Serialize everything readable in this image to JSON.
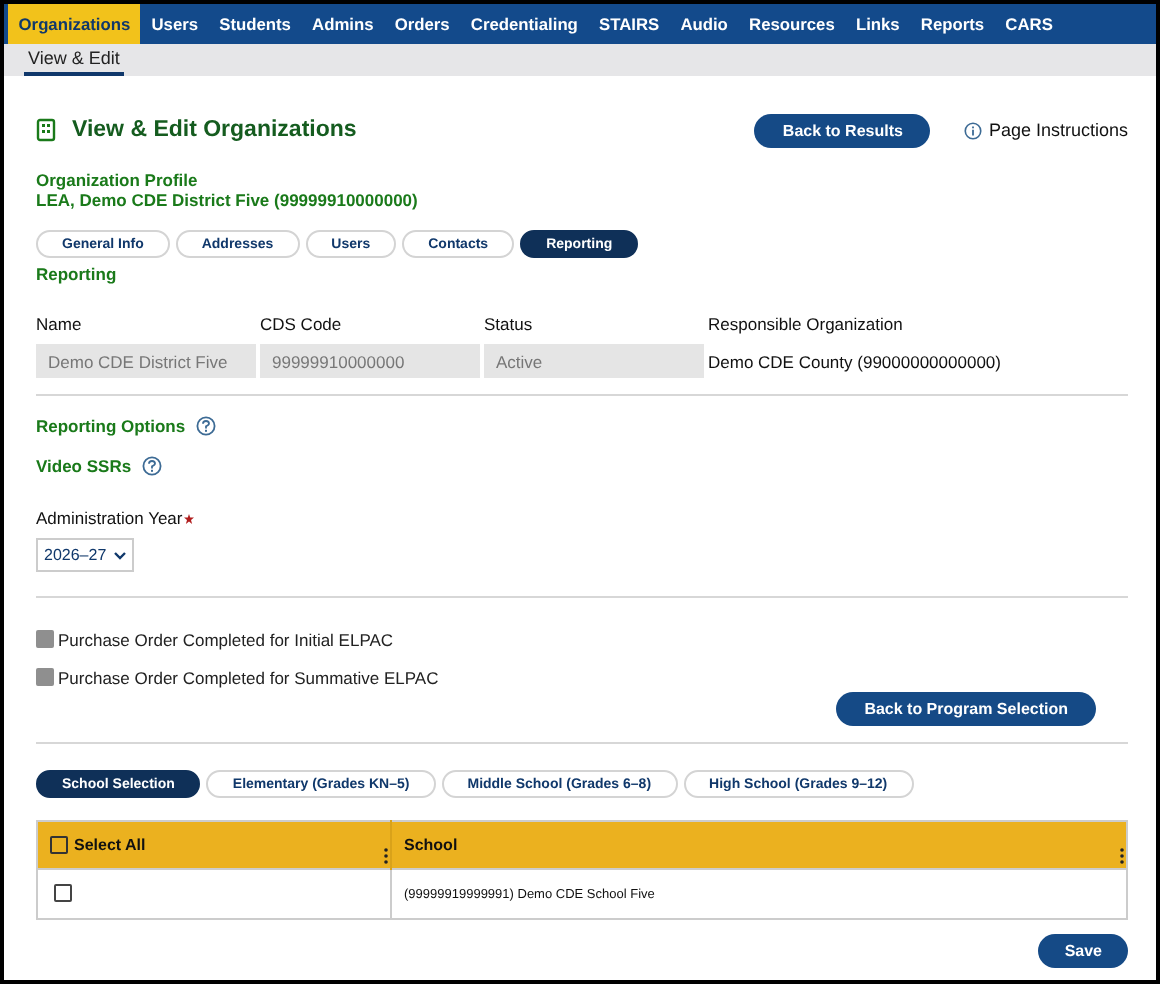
{
  "nav": {
    "items": [
      {
        "label": "Organizations",
        "selected": true
      },
      {
        "label": "Users",
        "selected": false
      },
      {
        "label": "Students",
        "selected": false
      },
      {
        "label": "Admins",
        "selected": false
      },
      {
        "label": "Orders",
        "selected": false
      },
      {
        "label": "Credentialing",
        "selected": false
      },
      {
        "label": "STAIRS",
        "selected": false
      },
      {
        "label": "Audio",
        "selected": false
      },
      {
        "label": "Resources",
        "selected": false
      },
      {
        "label": "Links",
        "selected": false
      },
      {
        "label": "Reports",
        "selected": false
      },
      {
        "label": "CARS",
        "selected": false
      }
    ]
  },
  "subnav": {
    "items": [
      {
        "label": "View & Edit",
        "selected": true
      }
    ]
  },
  "page": {
    "title": "View & Edit Organizations",
    "back_button": "Back to Results",
    "instructions": "Page Instructions"
  },
  "profile": {
    "heading": "Organization Profile",
    "name": "LEA, Demo CDE District Five (99999910000000)"
  },
  "tabs": [
    {
      "label": "General Info",
      "selected": false
    },
    {
      "label": "Addresses",
      "selected": false
    },
    {
      "label": "Users",
      "selected": false
    },
    {
      "label": "Contacts",
      "selected": false
    },
    {
      "label": "Reporting",
      "selected": true
    }
  ],
  "section_title": "Reporting",
  "fields": [
    {
      "label": "Name",
      "value": "Demo CDE District Five",
      "disabled": true
    },
    {
      "label": "CDS Code",
      "value": "99999910000000",
      "disabled": true
    },
    {
      "label": "Status",
      "value": "Active",
      "disabled": true
    },
    {
      "label": "Responsible Organization",
      "value": "Demo CDE County (99000000000000)",
      "disabled": false
    }
  ],
  "reporting_options": "Reporting Options",
  "video_ssrs": "Video SSRs",
  "admin_year": {
    "label": "Administration Year",
    "required": true,
    "value": "2026–27"
  },
  "purchase_orders": [
    {
      "label": "Purchase Order Completed for Initial ELPAC",
      "checked": false,
      "disabled": true
    },
    {
      "label": "Purchase Order Completed for Summative ELPAC",
      "checked": false,
      "disabled": true
    }
  ],
  "program_button": "Back to Program Selection",
  "school_tabs": [
    {
      "label": "School Selection",
      "selected": true
    },
    {
      "label": "Elementary (Grades KN–5)",
      "selected": false
    },
    {
      "label": "Middle School (Grades 6–8)",
      "selected": false
    },
    {
      "label": "High School (Grades 9–12)",
      "selected": false
    }
  ],
  "table": {
    "select_all": {
      "label": "Select All",
      "checked": false
    },
    "columns": [
      "School"
    ],
    "rows": [
      {
        "checked": false,
        "school": "(99999919999991) Demo CDE School Five"
      }
    ]
  },
  "save_button": "Save"
}
